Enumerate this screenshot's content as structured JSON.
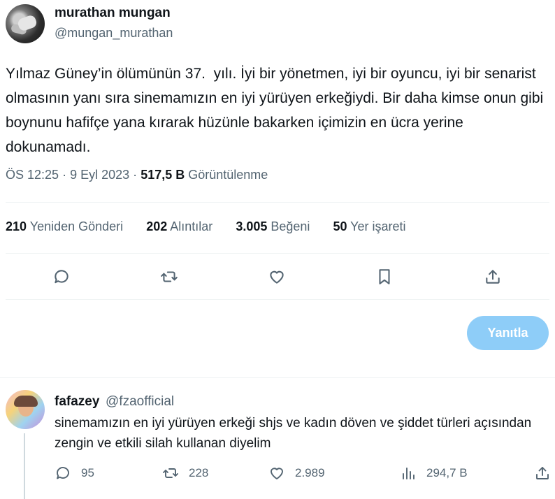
{
  "author": {
    "name": "murathan mungan",
    "handle": "@mungan_murathan"
  },
  "tweet": {
    "text": "Yılmaz Güney’in ölümünün 37.  yılı. İyi bir yönetmen, iyi bir oyuncu, iyi bir senarist olmasının yanı sıra sinemamızın en iyi yürüyen erkeğiydi. Bir daha kimse onun gibi boynunu hafifçe yana kırarak hüzünle bakarken içimizin en ücra yerine dokunamadı.",
    "time": "ÖS 12:25",
    "date": "9 Eyl 2023",
    "separator": "·",
    "views_count": "517,5 B",
    "views_label": "Görüntülenme"
  },
  "stats": [
    {
      "count": "210",
      "label": "Yeniden Gönderi"
    },
    {
      "count": "202",
      "label": "Alıntılar"
    },
    {
      "count": "3.005",
      "label": "Beğeni"
    },
    {
      "count": "50",
      "label": "Yer işareti"
    }
  ],
  "actions": {
    "icons": [
      "reply-icon",
      "retweet-icon",
      "like-icon",
      "bookmark-icon",
      "share-icon"
    ]
  },
  "reply_button": {
    "label": "Yanıtla"
  },
  "reply": {
    "name": "fafazey",
    "handle": "@fzaofficial",
    "text": "sinemamızın en iyi yürüyen erkeği shjs ve kadın döven ve şiddet türleri açısından zengin ve etkili silah kullanan diyelim",
    "replies": "95",
    "retweets": "228",
    "likes": "2.989",
    "views": "294,7 B"
  },
  "colors": {
    "text": "#0f1419",
    "secondary": "#536471",
    "reply_button_bg": "#8ecdf8",
    "divider": "#eff3f4"
  }
}
